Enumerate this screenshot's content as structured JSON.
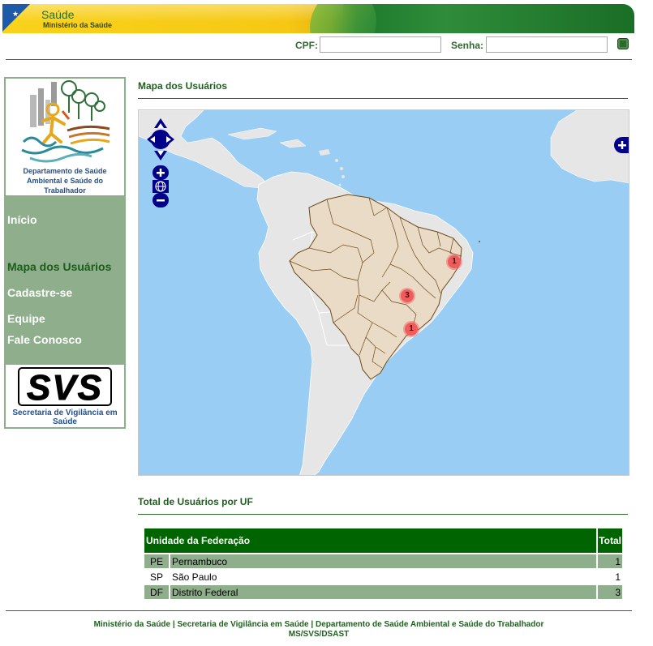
{
  "header": {
    "title": "Saúde",
    "subtitle": "Ministério da Saúde"
  },
  "login": {
    "cpf_label": "CPF:",
    "cpf_value": "",
    "senha_label": "Senha:",
    "senha_value": ""
  },
  "sidebar": {
    "logo_text": "Departamento de Saúde Ambiental e Saúde do Trabalhador",
    "nav": [
      {
        "label": "Início"
      },
      {
        "label": "Mapa dos Usuários"
      },
      {
        "label": "Cadastre-se"
      },
      {
        "label": "Equipe"
      },
      {
        "label": "Fale Conosco"
      }
    ],
    "svs_logo": "SVS",
    "svs_text": "Secretaria de Vigilância em Saúde"
  },
  "map_section": {
    "title": "Mapa dos Usuários",
    "markers": [
      {
        "count": "1",
        "uf": "PE"
      },
      {
        "count": "3",
        "uf": "DF"
      },
      {
        "count": "1",
        "uf": "SP"
      }
    ]
  },
  "table_section": {
    "title": "Total de Usuários por UF",
    "headers": {
      "uf": "Unidade da Federação",
      "total": "Total"
    },
    "rows": [
      {
        "sigla": "PE",
        "nome": "Pernambuco",
        "total": "1"
      },
      {
        "sigla": "SP",
        "nome": "São Paulo",
        "total": "1"
      },
      {
        "sigla": "DF",
        "nome": "Distrito Federal",
        "total": "3"
      }
    ]
  },
  "footer": {
    "line1_a": "Ministério da Saúde",
    "line1_b": "Secretaria de Vigilância em Saúde",
    "line1_c": "Departamento de Saúde Ambiental e Saúde do Trabalhador",
    "line2": "MS/SVS/DSAST",
    "separator": "|"
  },
  "colors": {
    "primary_green": "#006400",
    "sidebar_green": "#8fae8c",
    "ocean": "#99cdf3",
    "land": "#e6e6e6",
    "brazil": "#eadbc6",
    "marker": "#f05c5c",
    "nav_control": "#00008b"
  },
  "icons": {
    "pan": "pan-arrows-icon",
    "zoom_in": "zoom-in-icon",
    "world": "world-icon",
    "zoom_out": "zoom-out-icon",
    "layer_switcher": "layer-switcher-plus-icon",
    "submit": "login-submit-icon"
  }
}
